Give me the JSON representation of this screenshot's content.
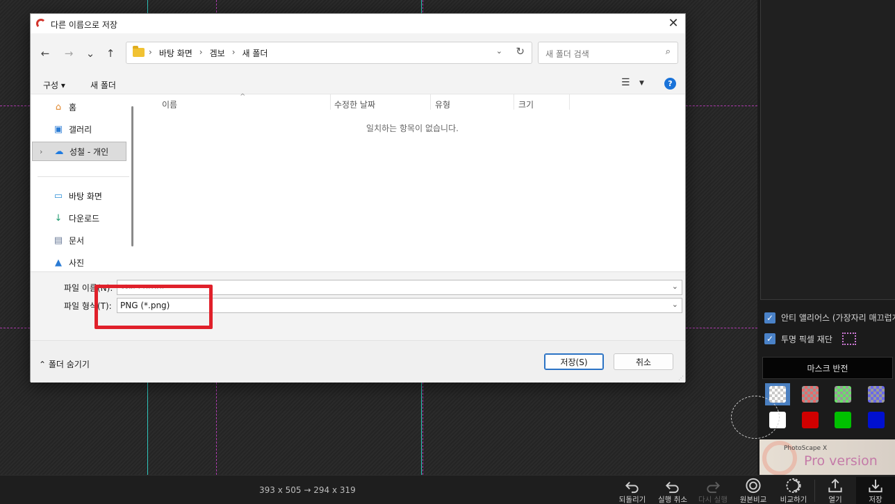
{
  "dialog": {
    "title": "다른 이름으로 저장",
    "close_glyph": "✕",
    "nav": {
      "back": "←",
      "forward": "→",
      "recent": "⌄",
      "up": "↑"
    },
    "address": {
      "crumbs": [
        "바탕 화면",
        "겜보",
        "새 폴더"
      ],
      "separator": "›",
      "dropdown_glyph": "⌄",
      "refresh_glyph": "↻"
    },
    "search": {
      "placeholder": "새 폴더 검색",
      "icon": "⌕"
    },
    "commands": {
      "organize": "구성 ▾",
      "new_folder": "새 폴더",
      "view_glyph": "☰",
      "view_dd": "▼",
      "help": "?"
    },
    "sidebar": {
      "items": [
        {
          "label": "홈",
          "icon": "home-icon",
          "glyph": "⌂"
        },
        {
          "label": "갤러리",
          "icon": "gallery-icon",
          "glyph": "▣"
        },
        {
          "label": "성철 - 개인",
          "icon": "cloud-icon",
          "glyph": "☁",
          "expand": "›"
        },
        {
          "label": "바탕 화면",
          "icon": "desktop-icon",
          "glyph": "▭",
          "pin": "📌"
        },
        {
          "label": "다운로드",
          "icon": "download-icon",
          "glyph": "↓",
          "pin": "📌"
        },
        {
          "label": "문서",
          "icon": "document-icon",
          "glyph": "▤",
          "pin": "📌"
        },
        {
          "label": "사진",
          "icon": "pictures-icon",
          "glyph": "▲",
          "pin": "📌"
        }
      ]
    },
    "columns": [
      "이름",
      "수정한 날짜",
      "유형",
      "크기"
    ],
    "sort_glyph": "^",
    "empty_message": "일치하는 항목이 없습니다.",
    "file_name_label": "파일 이름(N):",
    "file_name_value": "사진 cutout",
    "file_type_label": "파일 형식(T):",
    "file_type_value": "PNG (*.png)",
    "dropdown_glyph": "⌄",
    "hide_folders": "⌃  폴더 숨기기",
    "save_button": "저장(S)",
    "cancel_button": "취소"
  },
  "right_panel": {
    "antialias_label": "안티 앨리어스 (가장자리 매끄럽게)",
    "transparent_crop_label": "투명 픽셀 재단",
    "check_glyph": "✓",
    "mask_invert": "마스크 반전",
    "swatches": [
      {
        "name": "transparent",
        "color": "#c8c8c8",
        "selected": true
      },
      {
        "name": "red-checker",
        "color": "#e86a6a"
      },
      {
        "name": "green-checker",
        "color": "#6ae06a"
      },
      {
        "name": "blue-checker",
        "color": "#6a6ae8"
      },
      {
        "name": "white",
        "color": "#ffffff"
      },
      {
        "name": "red",
        "color": "#d00000"
      },
      {
        "name": "green",
        "color": "#00c000"
      },
      {
        "name": "blue",
        "color": "#0010d0"
      }
    ],
    "banner_small": "PhotoScape X",
    "banner_big": "Pro version"
  },
  "bottom_bar": {
    "size_info": "393 x 505 → 294 x 319",
    "tools": [
      {
        "label": "되돌리기",
        "icon": "revert-icon",
        "disabled": false
      },
      {
        "label": "실행 취소",
        "icon": "undo-icon",
        "disabled": false
      },
      {
        "label": "다시 실행",
        "icon": "redo-icon",
        "disabled": true
      },
      {
        "label": "원본비교",
        "icon": "compare-original-icon",
        "disabled": false
      },
      {
        "label": "비교하기",
        "icon": "compare-icon",
        "disabled": false
      },
      {
        "label": "열기",
        "icon": "open-icon",
        "disabled": false
      },
      {
        "label": "저장",
        "icon": "save-icon",
        "disabled": false
      }
    ]
  }
}
